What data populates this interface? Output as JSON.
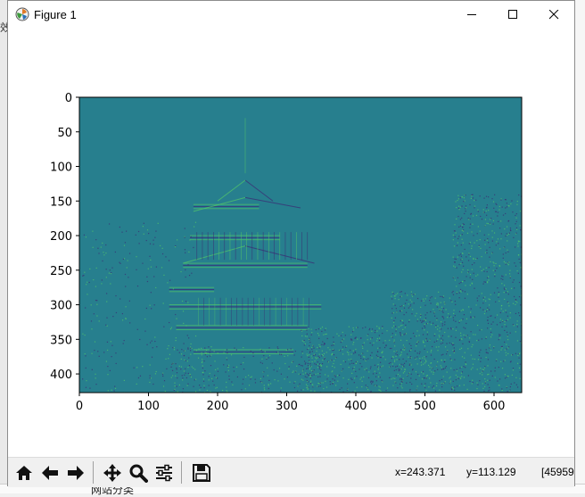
{
  "window": {
    "title": "Figure 1",
    "controls": {
      "minimize": "–",
      "maximize": "☐",
      "close": "✕"
    }
  },
  "background": {
    "left_text": "效",
    "bottom_text": "网站分类"
  },
  "plot": {
    "image_description_colormap": "viridis",
    "colors": {
      "image_base": "#277f8e",
      "edge_light": "#52c569",
      "edge_dark": "#3b2c74"
    },
    "x_ticks": [
      "0",
      "100",
      "200",
      "300",
      "400",
      "500",
      "600"
    ],
    "y_ticks": [
      "0",
      "50",
      "100",
      "150",
      "200",
      "250",
      "300",
      "350",
      "400"
    ]
  },
  "chart_data": {
    "type": "heatmap",
    "image_extent_x": [
      0,
      640
    ],
    "image_extent_y": [
      427,
      0
    ],
    "x_tick_values": [
      0,
      100,
      200,
      300,
      400,
      500,
      600
    ],
    "y_tick_values": [
      0,
      50,
      100,
      150,
      200,
      250,
      300,
      350,
      400
    ],
    "grid": false
  },
  "toolbar": {
    "buttons": [
      {
        "name": "home-icon",
        "label": "Home"
      },
      {
        "name": "back-icon",
        "label": "Back"
      },
      {
        "name": "forward-icon",
        "label": "Forward"
      },
      {
        "name": "pan-icon",
        "label": "Pan"
      },
      {
        "name": "zoom-icon",
        "label": "Zoom"
      },
      {
        "name": "configure-subplots-icon",
        "label": "Subplots"
      },
      {
        "name": "save-icon",
        "label": "Save"
      }
    ],
    "coords": {
      "x_text": "x=243.371",
      "y_text": "y=113.129",
      "value_text": "[45959"
    }
  }
}
